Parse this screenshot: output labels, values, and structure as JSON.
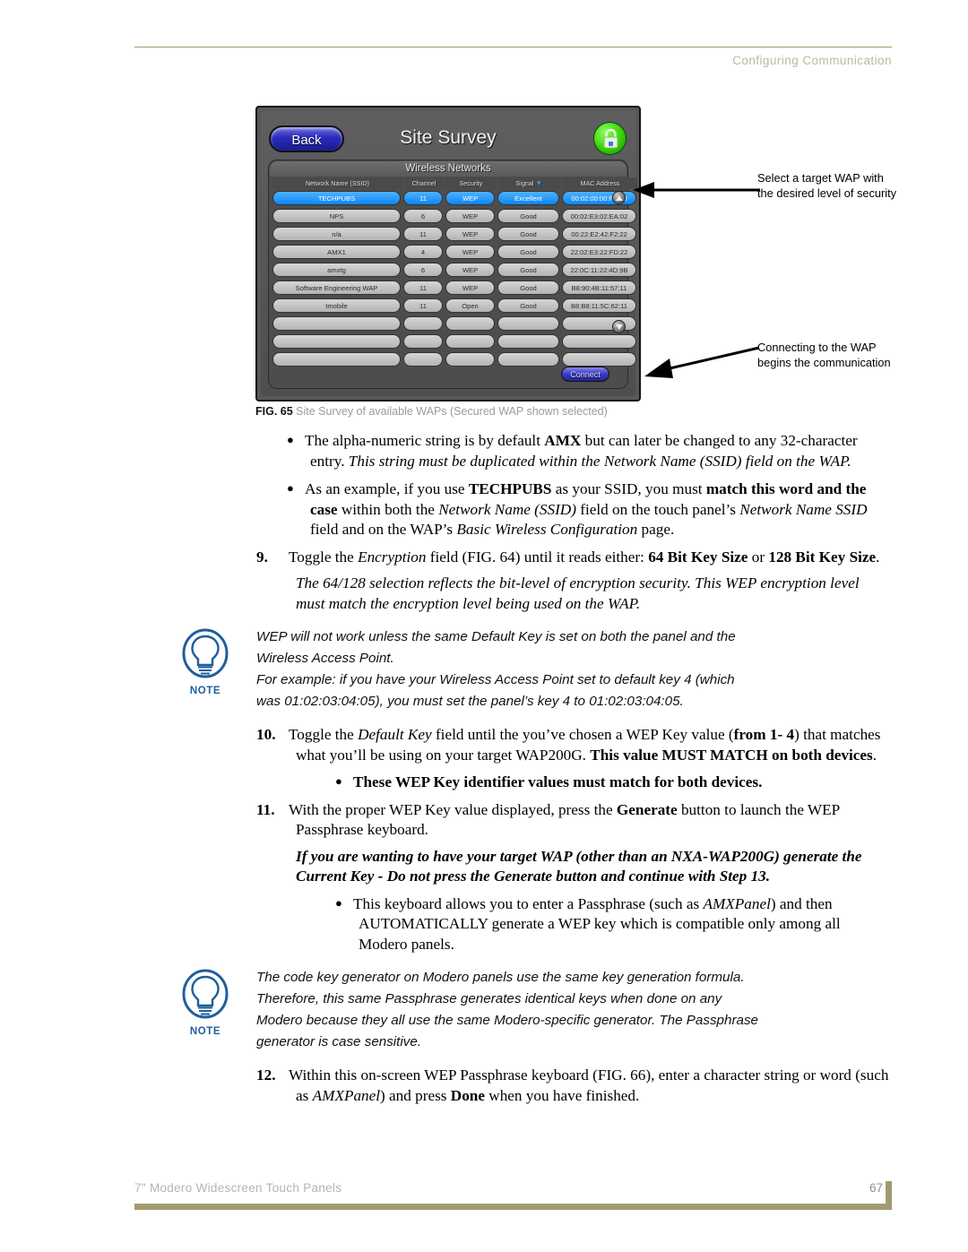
{
  "header": {
    "title": "Configuring Communication"
  },
  "figure": {
    "caption_number": "FIG. 65",
    "caption_text": "Site Survey of available WAPs (Secured WAP shown selected)",
    "panel": {
      "back_label": "Back",
      "title": "Site Survey",
      "lock_icon": "padlock-icon",
      "list_title": "Wireless Networks",
      "columns": [
        "Network Name (SSID)",
        "Channel",
        "Security",
        "Signal",
        "MAC Address"
      ],
      "sort_column": "Signal",
      "sort_caret": "▼",
      "rows": [
        {
          "ssid": "TECHPUBS",
          "channel": "11",
          "security": "WEP",
          "signal": "Excellent",
          "mac": "00:02:00:00:FB:00",
          "selected": true
        },
        {
          "ssid": "NPS",
          "channel": "6",
          "security": "WEP",
          "signal": "Good",
          "mac": "00:02:E3:02:EA:02",
          "selected": false
        },
        {
          "ssid": "n/a",
          "channel": "11",
          "security": "WEP",
          "signal": "Good",
          "mac": "00:22:E2:42:F2:22",
          "selected": false
        },
        {
          "ssid": "AMX1",
          "channel": "4",
          "security": "WEP",
          "signal": "Good",
          "mac": "22:02:E3:22:FD:22",
          "selected": false
        },
        {
          "ssid": "amxtg",
          "channel": "6",
          "security": "WEP",
          "signal": "Good",
          "mac": "22:0C:11:22:4D:9B",
          "selected": false
        },
        {
          "ssid": "Software Engineering WAP",
          "channel": "11",
          "security": "WEP",
          "signal": "Good",
          "mac": "B8:90:4B:11:57:11",
          "selected": false
        },
        {
          "ssid": "tmobile",
          "channel": "11",
          "security": "Open",
          "signal": "Good",
          "mac": "B8:B8:11:5C:62:11",
          "selected": false
        },
        {
          "ssid": "",
          "channel": "",
          "security": "",
          "signal": "",
          "mac": "",
          "selected": false
        },
        {
          "ssid": "",
          "channel": "",
          "security": "",
          "signal": "",
          "mac": "",
          "selected": false
        },
        {
          "ssid": "",
          "channel": "",
          "security": "",
          "signal": "",
          "mac": "",
          "selected": false
        }
      ],
      "connect_label": "Connect",
      "scroll_up_icon": "scroll-up-arrow-icon",
      "scroll_down_icon": "scroll-down-arrow-icon"
    },
    "callouts": [
      {
        "text": "Select a target WAP with the desired level of security"
      },
      {
        "text": "Connecting to the WAP begins the communication"
      }
    ]
  },
  "body": {
    "bullet_1": {
      "part1": "The alpha-numeric string is by default ",
      "bold1": "AMX",
      "part2": " but can later be changed to any 32-character entry. ",
      "italic1": "This string must be duplicated within the Network Name (SSID) field on the WAP."
    },
    "bullet_2": {
      "p1": "As an example, if you use ",
      "b1": "TECHPUBS",
      "p2": " as your SSID, you must ",
      "b2": "match this word and the case",
      "p3": " within both the ",
      "i1": "Network Name (SSID)",
      "p4": " field on the touch panel’s ",
      "i2": "Network Name SSID",
      "p5": " field and on the WAP’s ",
      "i3": "Basic Wireless Configuration",
      "p6": " page."
    },
    "step_9": {
      "num": "9.",
      "p1": "Toggle the ",
      "i1": "Encryption",
      "p2": " field (FIG. 64) until it reads either: ",
      "b1": "64 Bit Key Size",
      "p3": " or ",
      "b2": "128 Bit Key Size",
      "p4": ".",
      "italic_line": "The 64/128 selection reflects the bit-level of encryption security. This WEP encryption level must match the encryption level being used on the WAP."
    },
    "note_1": {
      "label": "NOTE",
      "icon": "lightbulb-icon",
      "line1": "WEP will not work unless the same Default Key is set on both the panel and the",
      "line2": "Wireless Access Point.",
      "line3": "For example: if you have your Wireless Access Point set to default key 4 (which",
      "line4": "was 01:02:03:04:05), you must set the panel’s key 4 to 01:02:03:04:05."
    },
    "step_10": {
      "num": "10.",
      "p1": "Toggle the ",
      "i1": "Default Key",
      "p2": " field until the you’ve chosen a WEP Key value (",
      "b1": "from 1- 4",
      "p3": ") that matches what you’ll be using on your target WAP200G. ",
      "b2": "This value MUST MATCH on both devices",
      "p4": "."
    },
    "bullet_3": {
      "bold_text": "These WEP Key identifier values must match for both devices."
    },
    "step_11": {
      "num": "11.",
      "p1": "With the proper WEP Key value displayed, press the ",
      "b1": "Generate",
      "p2": " button to launch the WEP Passphrase keyboard.",
      "bolditalic_line": "If you are wanting to have your target WAP (other than an NXA-WAP200G) generate the Current Key - Do not press the Generate button and continue with Step 13."
    },
    "bullet_4": {
      "p1": "This keyboard allows you to enter a Passphrase (such as ",
      "i1": "AMXPanel",
      "p2": ") and then AUTOMATICALLY generate a WEP key which is compatible only among all Modero panels."
    },
    "note_2": {
      "label": "NOTE",
      "icon": "lightbulb-icon",
      "line1": "The code key generator on Modero panels use the same key generation formula.",
      "line2": "Therefore, this same Passphrase generates identical keys when done on any",
      "line3": "Modero because they all use the same Modero-specific generator. The Passphrase",
      "line4": "generator is case sensitive."
    },
    "step_12": {
      "num": "12.",
      "p1": "Within this on-screen WEP Passphrase keyboard (FIG. 66), enter a character string or word (such as ",
      "i1": "AMXPanel",
      "p2": ") and press ",
      "b1": "Done",
      "p3": " when you have finished."
    }
  },
  "footer": {
    "document_title": "7\" Modero Widescreen Touch Panels",
    "page_number": "67"
  },
  "colors": {
    "rule": "#a39b6f",
    "header_text": "#bfb89a",
    "note_blue": "#1f5f9e",
    "selection_blue": "#0d86f5",
    "lock_green": "#36d106"
  }
}
